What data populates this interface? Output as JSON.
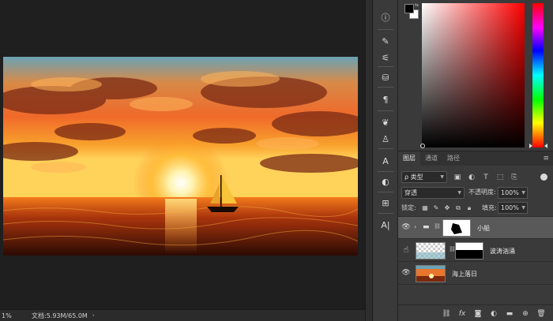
{
  "status_bar": {
    "zoom": "1%",
    "doc_info": "文档:5.93M/65.0M",
    "arrow": "›"
  },
  "tools": [
    {
      "name": "info-icon",
      "glyph": "ⓘ"
    },
    {
      "name": "brush-settings-icon",
      "glyph": "✎"
    },
    {
      "name": "adjust-sliders-icon",
      "glyph": "⚟"
    },
    {
      "name": "clone-source-icon",
      "glyph": "⛁"
    },
    {
      "name": "paragraph-icon",
      "glyph": "¶"
    },
    {
      "name": "brushes-icon",
      "glyph": "❦"
    },
    {
      "name": "character-styles-icon",
      "glyph": "♙"
    },
    {
      "name": "character-icon",
      "glyph": "A"
    },
    {
      "name": "properties-icon",
      "glyph": "◐"
    },
    {
      "name": "glyphs-icon",
      "glyph": "⊞"
    },
    {
      "name": "paragraph-styles-icon",
      "glyph": "A|"
    }
  ],
  "colors": {
    "foreground": "#000000",
    "background": "#ffffff",
    "hue": "#ff0000"
  },
  "layers_panel": {
    "tabs": [
      {
        "label": "图层",
        "active": true
      },
      {
        "label": "通道",
        "active": false
      },
      {
        "label": "路径",
        "active": false
      }
    ],
    "filter_kind": "ρ 类型",
    "blend_mode": "穿透",
    "opacity_label": "不透明度:",
    "opacity_value": "100%",
    "lock_label": "锁定:",
    "fill_label": "填充:",
    "fill_value": "100%",
    "layers": [
      {
        "name": "小船",
        "type": "group",
        "selected": true
      },
      {
        "name": "波涛汹涌",
        "type": "masked",
        "selected": false
      },
      {
        "name": "海上落日",
        "type": "image",
        "selected": false
      }
    ]
  }
}
